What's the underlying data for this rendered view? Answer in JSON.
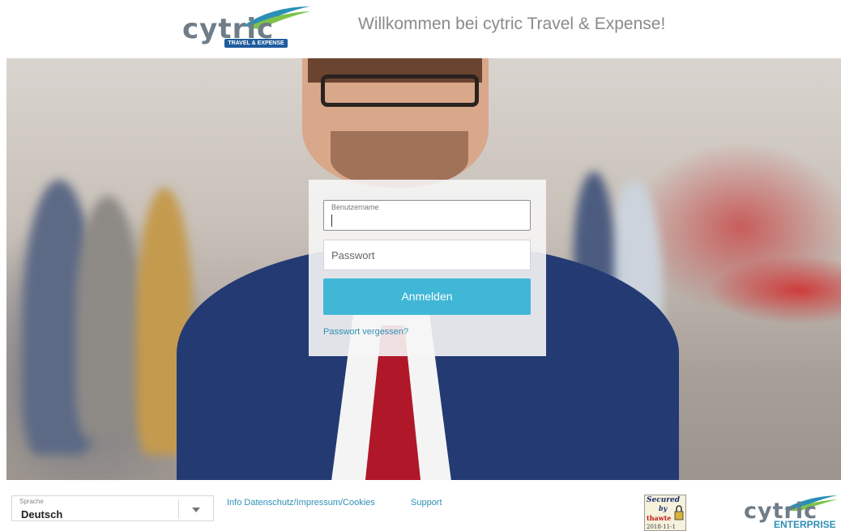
{
  "header": {
    "logo_text": "cytric",
    "logo_badge": "TRAVEL & EXPENSE",
    "welcome": "Willkommen bei cytric Travel & Expense!"
  },
  "login": {
    "username_label": "Benutzername",
    "username_value": "",
    "password_placeholder": "Passwort",
    "submit_label": "Anmelden",
    "forgot_label": "Passwort vergessen?"
  },
  "footer": {
    "language_label": "Sprache",
    "language_value": "Deutsch",
    "links": [
      "Info Datenschutz/Impressum/Cookies",
      "Support"
    ],
    "secured_line1": "Secured",
    "secured_line2": "by",
    "secured_brand": "thawte",
    "secured_date": "2018-11-1",
    "logo_text": "cytric",
    "logo_sub": "ENTERPRISE"
  },
  "colors": {
    "accent": "#40b7d7",
    "link": "#2f8fb5",
    "logo_gray": "#6f7d88"
  },
  "icons": [
    "logo-swoosh-icon",
    "chevron-down-icon",
    "lock-icon"
  ]
}
